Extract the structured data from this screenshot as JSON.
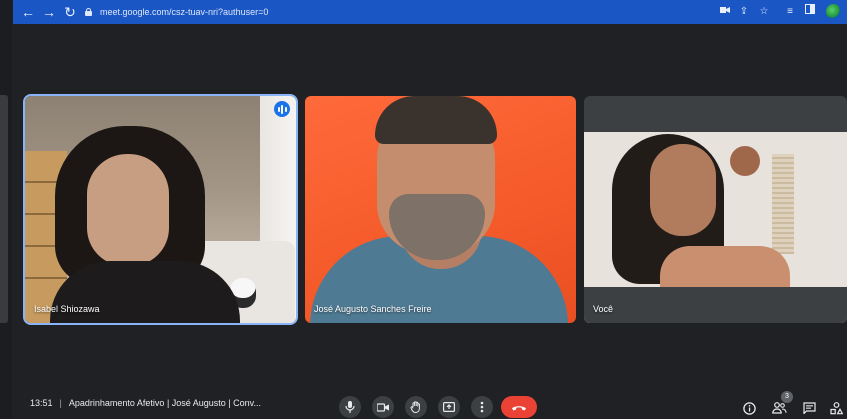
{
  "browser": {
    "url": "meet.google.com/csz-tuav-nri?authuser=0"
  },
  "participants": [
    {
      "name": "Isabel Shiozawa",
      "speaking": true
    },
    {
      "name": "José Augusto Sanches Freire",
      "speaking": false
    },
    {
      "name": "Você",
      "speaking": false
    }
  ],
  "meeting": {
    "time": "13:51",
    "separator": "|",
    "title": "Apadrinhamento Afetivo | José Augusto | Conv..."
  },
  "people_count": "3",
  "icons": {
    "back": "arrow-left-icon",
    "forward": "arrow-right-icon",
    "reload": "reload-icon",
    "mic": "microphone-icon",
    "camera": "camera-icon",
    "hand": "raise-hand-icon",
    "present": "present-screen-icon",
    "more": "more-options-icon",
    "hangup": "hang-up-icon",
    "info": "info-icon",
    "people": "people-icon",
    "chat": "chat-icon",
    "activities": "activities-icon"
  },
  "colors": {
    "chrome_bar": "#1a56c4",
    "background": "#202124",
    "hangup": "#ea4335",
    "speaking_border": "#8ab4f8"
  }
}
